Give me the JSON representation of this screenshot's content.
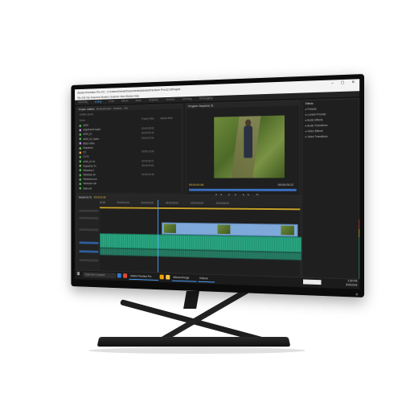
{
  "app": {
    "title": "Adobe Premiere Pro CC - C:\\Users\\Owner\\Documents\\Adobe\\Premiere Pro\\12.0\\Project",
    "menu": "File  Edit  Clip  Sequence  Markers  Graphics  View  Window  Help",
    "workspaces": [
      "Assembly",
      "Editing",
      "Color",
      "Effects",
      "Audio",
      "Graphics",
      "Libraries",
      "Learning",
      "Metalogging"
    ],
    "active_workspace": "Editing"
  },
  "project_panel": {
    "tabs": [
      "Project: Untitled",
      "Media Browser",
      "Libraries",
      "Info"
    ],
    "path": "Untitled.prproj",
    "items": [
      {
        "name": "A020",
        "color": "#4caf50",
        "frame": ""
      },
      {
        "name": "Adjustment Layer",
        "color": "#b58be6",
        "frame": "00:00:05:00"
      },
      {
        "name": "A020_01",
        "color": "#4caf50",
        "frame": "00:00:04:12"
      },
      {
        "name": "A020_02_Audio",
        "color": "#4caf50",
        "frame": "00:00:07:04"
      },
      {
        "name": "Black Video",
        "color": "#b58be6",
        "frame": ""
      },
      {
        "name": "Sequence",
        "color": "#6ab04c",
        "frame": ""
      },
      {
        "name": "C2",
        "color": "#e6a23c",
        "frame": "00:00:12:09"
      },
      {
        "name": "C2 01",
        "color": "#4caf50",
        "frame": ""
      },
      {
        "name": "A020_01 01",
        "color": "#4caf50",
        "frame": "00:00:06:21"
      },
      {
        "name": "Sequence 01",
        "color": "#6ab04c",
        "frame": "00:00:09:02"
      },
      {
        "name": "Windows 2",
        "color": "#4caf50",
        "frame": ""
      },
      {
        "name": "Windows 10",
        "color": "#4caf50",
        "frame": "00:00:03:15"
      },
      {
        "name": "Windows Icon",
        "color": "#4caf50",
        "frame": ""
      },
      {
        "name": "Windows reel",
        "color": "#4caf50",
        "frame": ""
      },
      {
        "name": "Wall end",
        "color": "#4caf50",
        "frame": ""
      }
    ],
    "columns": [
      "Name",
      "Frame Rate",
      "Media Start"
    ]
  },
  "program_monitor": {
    "tab": "Program: Sequence 01",
    "timecode": "00:00:01:08",
    "duration": "00:00:20:12",
    "controls": "◀◀ ◀ ▶ ▶▶ ⟳"
  },
  "effects_panel": {
    "title": "Effects",
    "items": [
      "Presets",
      "Lumetri Presets",
      "Audio Effects",
      "Audio Transitions",
      "Video Effects",
      "Video Transitions"
    ]
  },
  "timeline": {
    "tab": "Sequence 01",
    "timecode": "00:00:01:08",
    "ruler": [
      "00:00",
      "00:00:01:00",
      "00:00:02:00",
      "00:00:03:00",
      "00:00:04:00",
      "00:00:05:00"
    ],
    "tracks": [
      "V3",
      "V2",
      "V1",
      "A1",
      "A2",
      "A3"
    ]
  },
  "taskbar": {
    "search_placeholder": "Type here to search",
    "apps": [
      "Adobe Premiere Pro",
      "Microsoft Edge",
      "Outlook"
    ],
    "time": "2:30 PM",
    "date": "5/20/2018",
    "colors": {
      "edge": "#2b7cd3",
      "chrome": "#e04a3a",
      "store": "#f0a30a",
      "files": "#f6c343"
    }
  }
}
